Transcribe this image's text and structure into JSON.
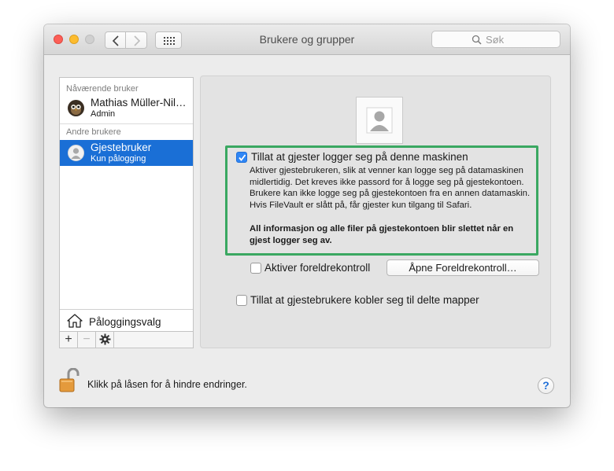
{
  "window": {
    "title": "Brukere og grupper",
    "search_placeholder": "Søk"
  },
  "sidebar": {
    "current_header": "Nåværende bruker",
    "current_user": {
      "name": "Mathias Müller-Nil…",
      "role": "Admin"
    },
    "others_header": "Andre brukere",
    "guest_user": {
      "name": "Gjestebruker",
      "role": "Kun pålogging",
      "selected": true
    },
    "login_options": "Påloggingsvalg",
    "add_label": "+",
    "remove_label": "−",
    "gear_label": "✱"
  },
  "main": {
    "allow_guests": {
      "checked": true,
      "label": "Tillat at gjester logger seg på denne maskinen",
      "description": "Aktiver gjestebrukeren, slik at venner kan logge seg på datamaskinen midlertidig. Det kreves ikke passord for å logge seg på gjestekontoen. Brukere kan ikke logge seg på gjestekontoen fra en annen datamaskin. Hvis FileVault er slått på, får gjester kun tilgang til Safari.",
      "warning": "All informasjon og alle filer på gjestekontoen blir slettet når en gjest logger seg av."
    },
    "parental": {
      "checked": false,
      "label": "Aktiver foreldrekontroll",
      "button": "Åpne Foreldrekontroll…"
    },
    "shared_folders": {
      "checked": false,
      "label": "Tillat at gjestebrukere kobler seg til delte mapper"
    }
  },
  "footer": {
    "lock_text": "Klikk på låsen for å hindre endringer.",
    "help_label": "?"
  },
  "colors": {
    "selection": "#1a6fd6",
    "highlight_box": "#3aa861",
    "checkbox_checked": "#2f86f5"
  }
}
